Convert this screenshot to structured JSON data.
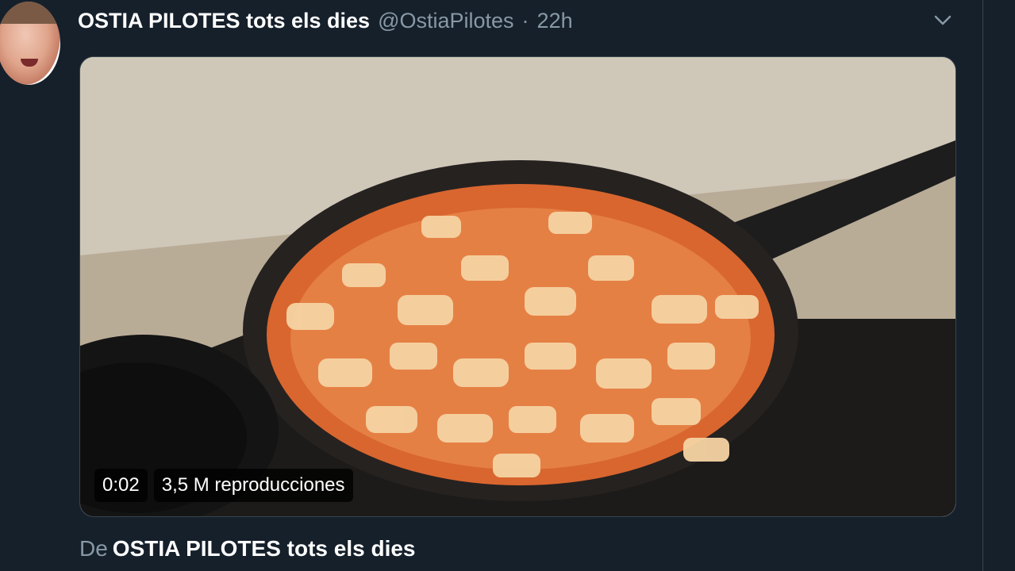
{
  "tweet": {
    "display_name": "OSTIA PILOTES tots els dies",
    "handle": "@OstiaPilotes",
    "separator": "·",
    "time": "22h",
    "menu_icon": "chevron-down-icon"
  },
  "video": {
    "duration": "0:02",
    "views": "3,5 M reproducciones"
  },
  "attribution": {
    "prefix": "De",
    "name": "OSTIA PILOTES tots els dies"
  },
  "colors": {
    "background": "#15202b",
    "secondary_text": "#8899a6",
    "border": "#38444d"
  }
}
